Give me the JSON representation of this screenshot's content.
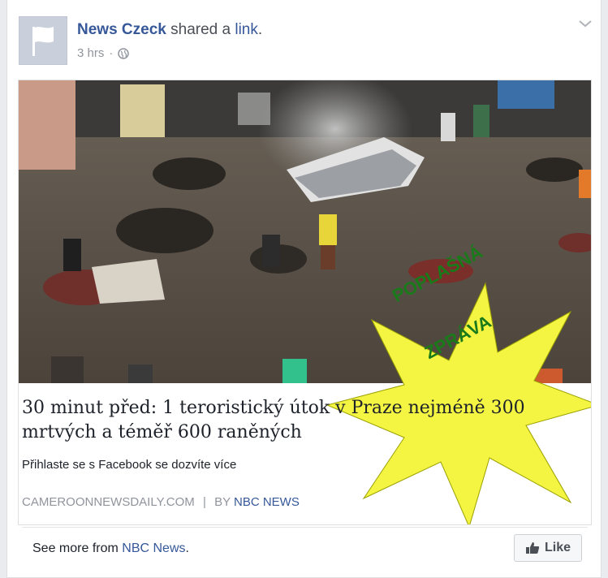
{
  "post": {
    "page_name": "News Czeck",
    "action_text": "shared a",
    "action_link": "link",
    "action_end": ".",
    "time": "3 hrs",
    "time_sep": "·",
    "icons": {
      "avatar": "flag-icon",
      "privacy": "globe-icon",
      "menu": "chevron-down-icon"
    }
  },
  "link": {
    "headline": "30 minut před: 1 teroristický útok v Praze nejméně 300 mrtvých a téměř 600 raněných",
    "description": "Přihlaste se s Facebook se dozvíte více",
    "domain": "CAMEROONNEWSDAILY.COM",
    "separator": "|",
    "by_label": "BY",
    "by_name": "NBC NEWS"
  },
  "overlay": {
    "line1": "POPLAŠNÁ",
    "line2": "ZPRÁVA",
    "fill_color": "#f4f542",
    "text_color": "#1a7a1a"
  },
  "footer": {
    "see_more_prefix": "See more from",
    "see_more_link": "NBC News",
    "see_more_suffix": ".",
    "like_label": "Like",
    "like_icon": "thumbs-up-icon"
  },
  "colors": {
    "link_blue": "#365899",
    "meta_gray": "#90949c",
    "text": "#1d2129"
  }
}
